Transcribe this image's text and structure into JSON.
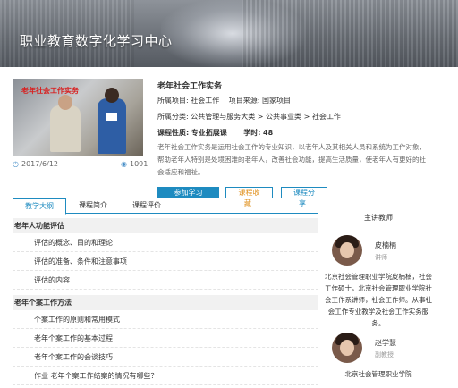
{
  "header": {
    "site_title": "职业教育数字化学习中心"
  },
  "course": {
    "cover_text": "老年社会工作实务",
    "date": "2017/6/12",
    "views": "1091",
    "title": "老年社会工作实务",
    "project_label": "所属项目:",
    "project": "社会工作",
    "source_label": "项目来源:",
    "source": "国家项目",
    "category_label": "所属分类:",
    "category": "公共管理与服务大类 > 公共事业类 > 社会工作",
    "nature_label": "课程性质:",
    "nature": "专业拓展课",
    "hours_label": "学时:",
    "hours": "48",
    "description": "老年社会工作实务是运用社会工作的专业知识，以老年人及其相关人员和系统为工作对象，帮助老年人特别是处境困难的老年人，改善社会功能，提高生活质量，使老年人有更好的社会适应和福祉。"
  },
  "actions": {
    "join": "参加学习",
    "collect": "课程收",
    "collect_overflow": "藏",
    "share": "课程分",
    "share_overflow": "享"
  },
  "tabs": [
    "教学大纲",
    "课程简介",
    "课程评价"
  ],
  "outline": [
    {
      "chapter": "老年人功能评估",
      "lessons": [
        "评估的概念、目的和理论",
        "评估的准备、条件和注意事项",
        "评估的内容"
      ]
    },
    {
      "chapter": "老年个案工作方法",
      "lessons": [
        "个案工作的原则和常用模式",
        "老年个案工作的基本过程",
        "老年个案工作的会谈技巧",
        "作业  老年个案工作结案的情况有哪些？"
      ]
    }
  ],
  "teachers": {
    "title": "主讲教师",
    "list": [
      {
        "name": "皮楠楠",
        "role": "讲师",
        "bio": "北京社会管理职业学院皮楠楠，社会工作硕士，北京社会管理职业学院社会工作系讲师，社会工作师。从事社会工作专业教学及社会工作实务服务。"
      },
      {
        "name": "赵学慧",
        "role": "副教授",
        "bio": "北京社会管理职业学院"
      }
    ]
  },
  "colors": {
    "accent": "#1e8bc0",
    "collect": "#e0901c",
    "cover_text": "#d82020"
  },
  "icons": {
    "date": "clock-icon",
    "views": "eye-icon"
  }
}
